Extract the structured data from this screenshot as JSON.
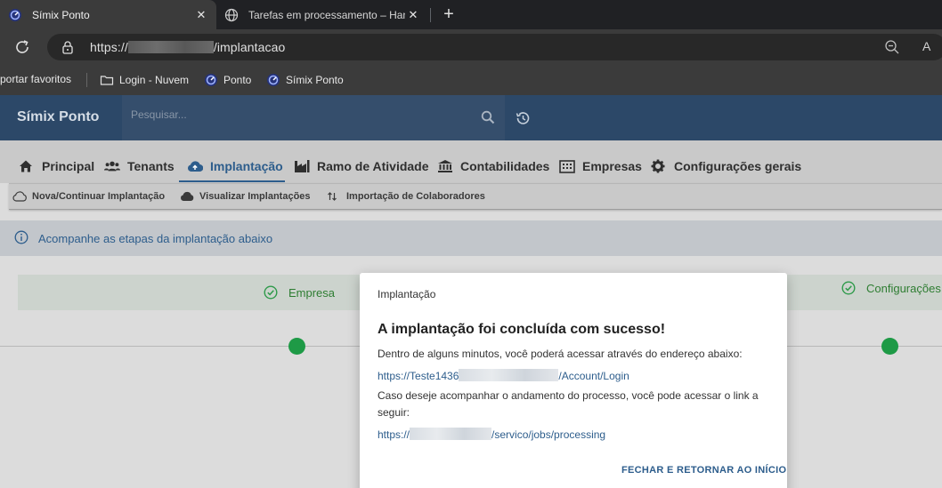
{
  "browser": {
    "tabs": [
      {
        "title": "Símix Ponto",
        "active": true
      },
      {
        "title": "Tarefas em processamento – Hang",
        "active": false
      }
    ],
    "close_glyph": "✕",
    "new_tab_glyph": "+",
    "url_prefix": "https://",
    "url_suffix": "/implantacao",
    "read_aloud": "A",
    "favorites": [
      {
        "label": "portar favoritos",
        "icon": "none"
      },
      {
        "label": "Login - Nuvem",
        "icon": "folder-icon"
      },
      {
        "label": "Ponto",
        "icon": "simix-logo-icon"
      },
      {
        "label": "Símix Ponto",
        "icon": "simix-logo-icon"
      }
    ]
  },
  "app": {
    "brand": "Símix Ponto",
    "search_placeholder": "Pesquisar..."
  },
  "nav": {
    "items": [
      {
        "label": "Principal",
        "icon": "home-icon"
      },
      {
        "label": "Tenants",
        "icon": "users-icon"
      },
      {
        "label": "Implantação",
        "icon": "cloud-upload-icon",
        "active": true
      },
      {
        "label": "Ramo de Atividade",
        "icon": "industry-icon"
      },
      {
        "label": "Contabilidades",
        "icon": "bank-icon"
      },
      {
        "label": "Empresas",
        "icon": "building-icon"
      },
      {
        "label": "Configurações gerais",
        "icon": "gear-icon"
      }
    ],
    "subitems": [
      {
        "label": "Nova/Continuar Implantação",
        "icon": "cloud-outline-icon"
      },
      {
        "label": "Visualizar Implantações",
        "icon": "cloud-filled-icon"
      },
      {
        "label": "Importação de Colaboradores",
        "icon": "sort-arrows-icon"
      }
    ]
  },
  "info": {
    "text": "Acompanhe as etapas da implantação abaixo"
  },
  "steps": [
    {
      "label": "Empresa",
      "done": true
    },
    {
      "label": "Configurações",
      "done": true
    }
  ],
  "modal": {
    "title": "Implantação",
    "heading": "A implantação foi concluída com sucesso!",
    "line1": "Dentro de alguns minutos, você poderá acessar através do endereço abaixo:",
    "link1_prefix": "https://Teste1436",
    "link1_suffix": "/Account/Login",
    "line2": "Caso deseje acompanhar o andamento do processo, você pode acessar o link a seguir:",
    "link2_prefix": "https://",
    "link2_suffix": "/servico/jobs/processing",
    "action": "FECHAR E RETORNAR AO INÍCIO"
  },
  "colors": {
    "primary": "#2d5d8c",
    "success": "#1e9a46",
    "header": "#2c4868"
  }
}
